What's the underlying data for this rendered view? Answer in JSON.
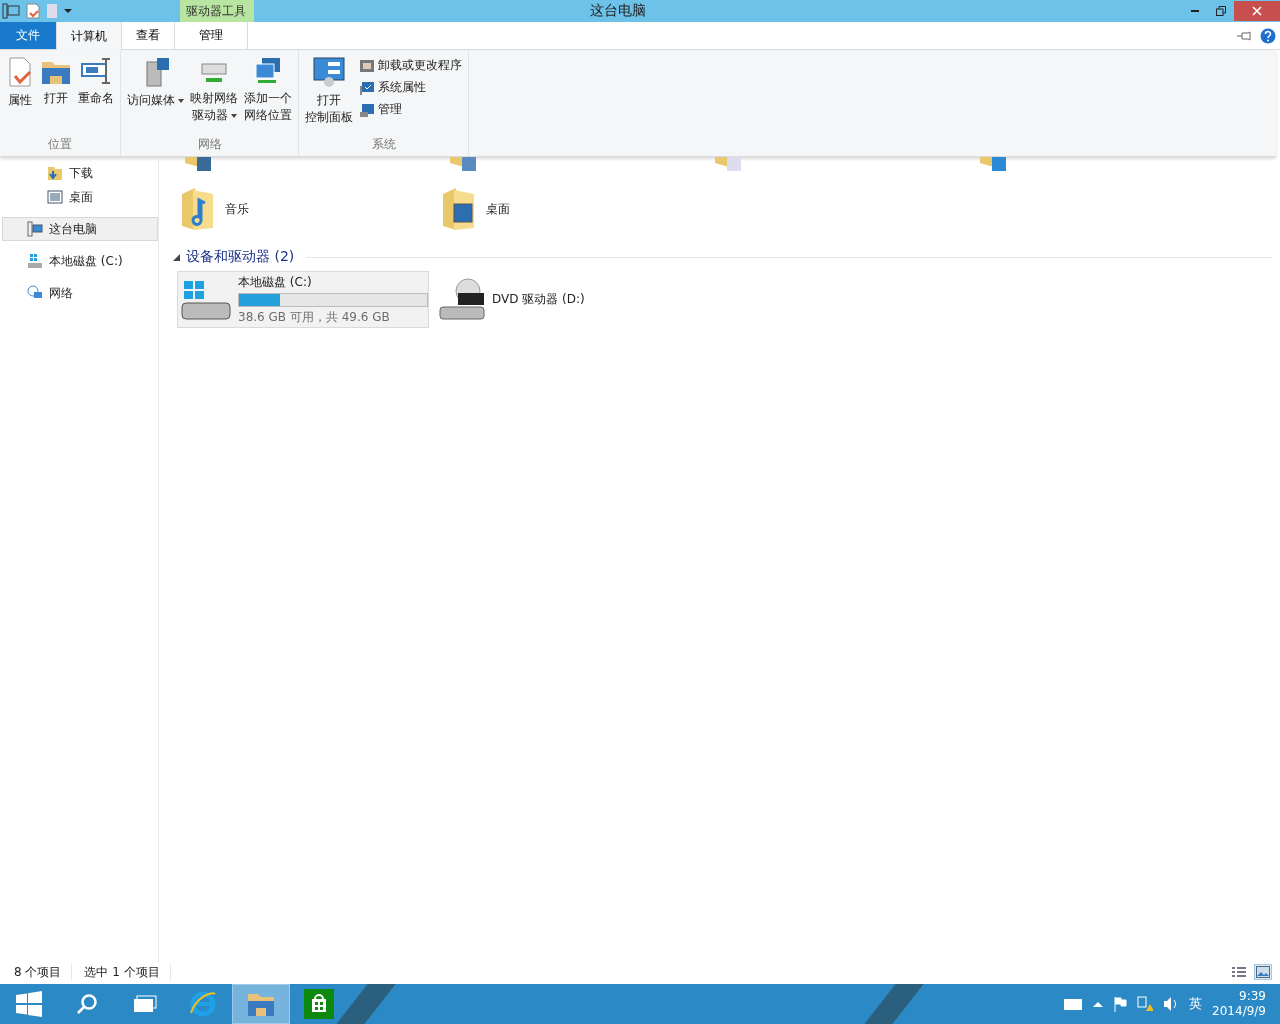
{
  "window": {
    "title": "这台电脑",
    "context_tab_group": "驱动器工具"
  },
  "tabs": [
    {
      "label": "文件",
      "kind": "file",
      "selected": false
    },
    {
      "label": "计算机",
      "kind": "normal",
      "selected": true
    },
    {
      "label": "查看",
      "kind": "normal",
      "selected": false
    },
    {
      "label": "管理",
      "kind": "context",
      "selected": false
    }
  ],
  "ribbon_groups": [
    {
      "label": "位置",
      "buttons": [
        {
          "label": "属性",
          "kind": "large"
        },
        {
          "label": "打开",
          "kind": "large"
        },
        {
          "label": "重命名",
          "kind": "large"
        }
      ]
    },
    {
      "label": "网络",
      "buttons": [
        {
          "label": "访问媒体",
          "kind": "large",
          "dropdown": true
        },
        {
          "label_lines": [
            "映射网络",
            "驱动器"
          ],
          "kind": "large",
          "dropdown": true
        },
        {
          "label_lines": [
            "添加一个",
            "网络位置"
          ],
          "kind": "large",
          "dropdown": false
        }
      ]
    },
    {
      "label": "系统",
      "buttons": [
        {
          "label_lines": [
            "打开",
            "控制面板"
          ],
          "kind": "large"
        },
        {
          "label": "卸载或更改程序",
          "kind": "small"
        },
        {
          "label": "系统属性",
          "kind": "small"
        },
        {
          "label": "管理",
          "kind": "small"
        }
      ]
    }
  ],
  "nav_pane": {
    "favorites_items": [
      {
        "label": "下载",
        "selected": false
      },
      {
        "label": "桌面",
        "selected": false
      }
    ],
    "items": [
      {
        "label": "这台电脑",
        "selected": true
      },
      {
        "label": "本地磁盘 (C:)",
        "selected": false
      },
      {
        "label": "网络",
        "selected": false
      }
    ]
  },
  "folders": [
    {
      "label": "音乐"
    },
    {
      "label": "桌面"
    }
  ],
  "devices_section": {
    "title": "设备和驱动器 (2)",
    "expanded": true,
    "drives": [
      {
        "name": "本地磁盘 (C:)",
        "kind": "disk",
        "selected": true,
        "level": 0.22,
        "space": "38.6 GB 可用，共 49.6 GB"
      },
      {
        "name": "DVD 驱动器 (D:)",
        "kind": "dvd",
        "selected": false
      }
    ]
  },
  "status_bar": {
    "item_count": "8 个项目",
    "selection": "选中 1 个项目",
    "view_buttons": [
      {
        "kind": "details",
        "selected": false
      },
      {
        "kind": "large_icons",
        "selected": true
      }
    ]
  },
  "taskbar": {
    "pinned": [
      {
        "kind": "ie",
        "active": false
      },
      {
        "kind": "explorer",
        "active": true
      },
      {
        "kind": "store",
        "active": false
      }
    ],
    "ime": "英",
    "time": "9:39",
    "date": "2014/9/9"
  }
}
